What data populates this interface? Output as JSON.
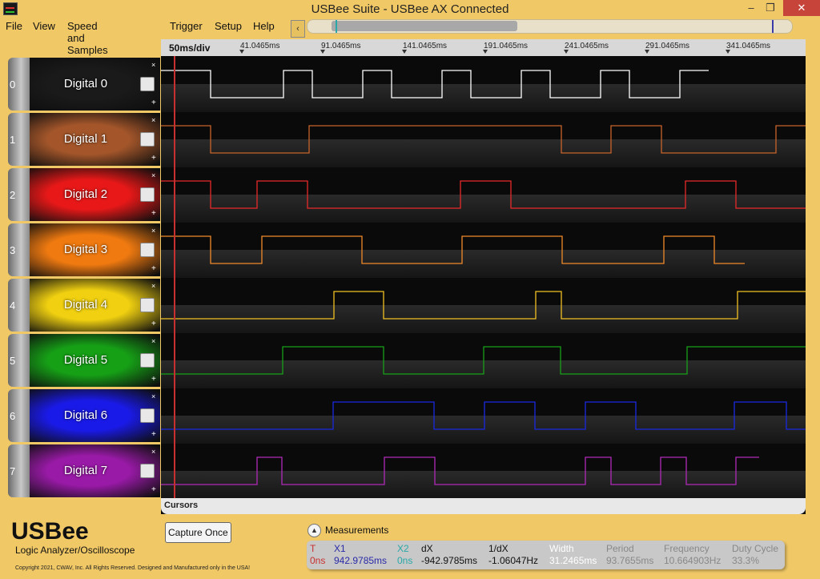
{
  "window": {
    "title": "USBee Suite - USBee AX Connected",
    "minimize": "–",
    "restore": "❐",
    "close": "✕"
  },
  "menu": [
    "File",
    "View",
    "Speed and Samples",
    "Trigger",
    "Setup",
    "Help"
  ],
  "overview": {
    "back_glyph": "‹"
  },
  "timebase": {
    "scale": "50ms/div",
    "ticks": [
      "41.0465ms",
      "91.0465ms",
      "141.0465ms",
      "191.0465ms",
      "241.0465ms",
      "291.0465ms",
      "341.0465ms"
    ]
  },
  "channels": [
    {
      "num": "0",
      "label": "Digital 0",
      "color": "#ffffff",
      "bg": "#1a1a1a",
      "close": "×",
      "add": "+"
    },
    {
      "num": "1",
      "label": "Digital 1",
      "color": "#c8642a",
      "bg": "#a4562a",
      "close": "×",
      "add": "+"
    },
    {
      "num": "2",
      "label": "Digital 2",
      "color": "#e82a2a",
      "bg": "#e81818",
      "close": "×",
      "add": "+"
    },
    {
      "num": "3",
      "label": "Digital 3",
      "color": "#f08a2a",
      "bg": "#f07a10",
      "close": "×",
      "add": "+"
    },
    {
      "num": "4",
      "label": "Digital 4",
      "color": "#f0c020",
      "bg": "#f0d010",
      "close": "×",
      "add": "+"
    },
    {
      "num": "5",
      "label": "Digital 5",
      "color": "#18a018",
      "bg": "#16a016",
      "close": "×",
      "add": "+"
    },
    {
      "num": "6",
      "label": "Digital 6",
      "color": "#1a28e0",
      "bg": "#1a1ae8",
      "close": "×",
      "add": "+"
    },
    {
      "num": "7",
      "label": "Digital 7",
      "color": "#b02ab8",
      "bg": "#9a1aa8",
      "close": "×",
      "add": "+"
    }
  ],
  "waveforms": [
    [
      1,
      0,
      1,
      0,
      1,
      0,
      1,
      0,
      1,
      0,
      1,
      0,
      1
    ],
    [
      1,
      0,
      1,
      0,
      1,
      0,
      1
    ],
    [
      1,
      0,
      1,
      0,
      1,
      0,
      1,
      0
    ],
    [
      1,
      0,
      1,
      0,
      1,
      0,
      1,
      0
    ],
    [
      0,
      1,
      0,
      1,
      0,
      1
    ],
    [
      0,
      1,
      0,
      1,
      0,
      1
    ],
    [
      0,
      1,
      0,
      1,
      0,
      1,
      0,
      1,
      0
    ],
    [
      0,
      1,
      0,
      1,
      0,
      1,
      0,
      1,
      0,
      1
    ]
  ],
  "cursors_label": "Cursors",
  "brand": {
    "logo": "USBee",
    "subtitle": "Logic Analyzer/Oscilloscope",
    "copyright": "Copyright 2021, CWAV, Inc. All Rights Reserved. Designed and Manufactured only in the USA!"
  },
  "capture_button": "Capture Once",
  "measurements": {
    "title": "Measurements",
    "toggle_glyph": "▲",
    "columns": [
      {
        "header": "T",
        "value": "0ns",
        "color": "#c83030"
      },
      {
        "header": "X1",
        "value": "942.9785ms",
        "color": "#2a2aa8"
      },
      {
        "header": "X2",
        "value": "0ns",
        "color": "#2aa8a8"
      },
      {
        "header": "dX",
        "value": "-942.9785ms",
        "color": "#111111"
      },
      {
        "header": "1/dX",
        "value": "-1.06047Hz",
        "color": "#111111"
      },
      {
        "header": "Width",
        "value": "31.2465ms",
        "color": "#ffffff"
      },
      {
        "header": "Period",
        "value": "93.7655ms",
        "color": "#888888"
      },
      {
        "header": "Frequency",
        "value": "10.664903Hz",
        "color": "#888888"
      },
      {
        "header": "Duty Cycle",
        "value": "33.3%",
        "color": "#888888"
      }
    ]
  }
}
